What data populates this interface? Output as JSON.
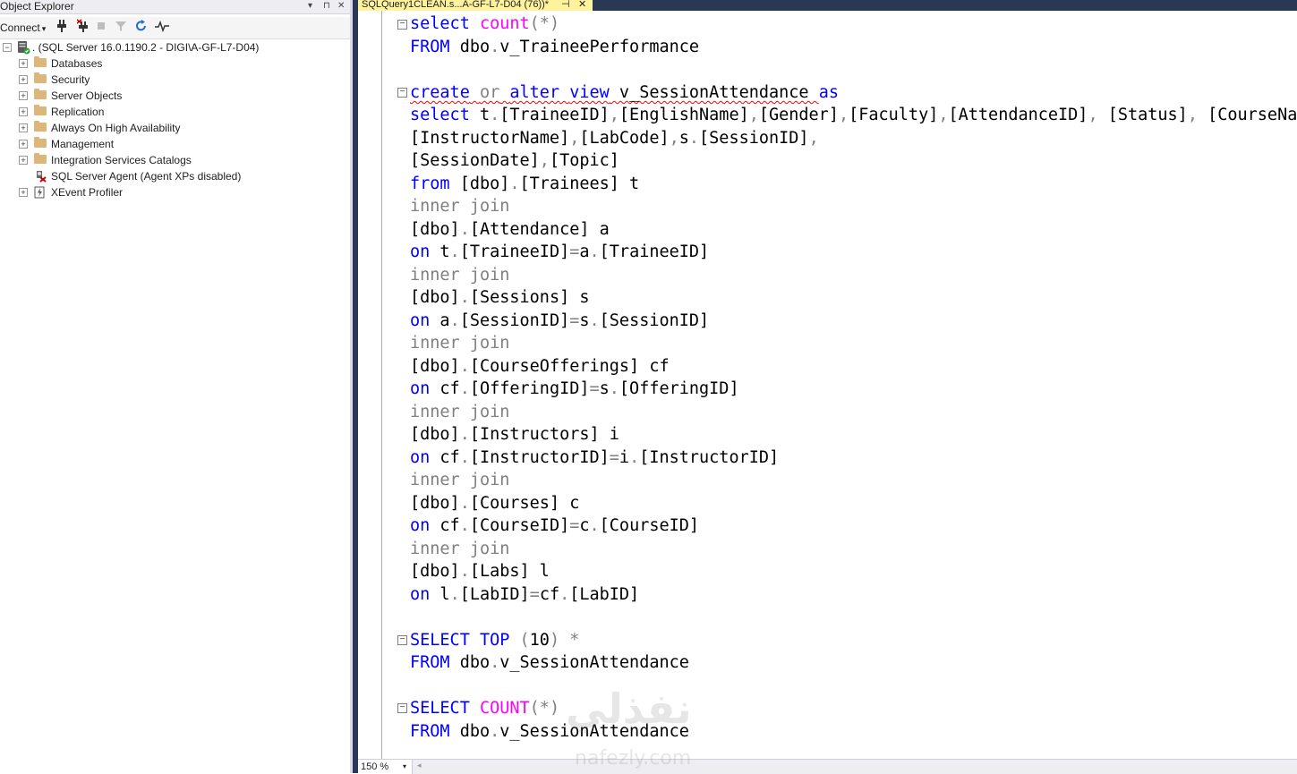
{
  "object_explorer": {
    "title": "Object Explorer",
    "title_controls": {
      "dropdown": "▾",
      "pin": "⊓",
      "close": "✕"
    },
    "toolbar": {
      "connect_label": "Connect",
      "connect_caret": "▾"
    },
    "server_node": ". (SQL Server 16.0.1190.2 - DIGI\\A-GF-L7-D04)",
    "items": [
      {
        "label": "Databases",
        "icon": "folder-icon"
      },
      {
        "label": "Security",
        "icon": "folder-icon"
      },
      {
        "label": "Server Objects",
        "icon": "folder-icon"
      },
      {
        "label": "Replication",
        "icon": "folder-icon"
      },
      {
        "label": "Always On High Availability",
        "icon": "folder-icon"
      },
      {
        "label": "Management",
        "icon": "folder-icon"
      },
      {
        "label": "Integration Services Catalogs",
        "icon": "folder-icon"
      },
      {
        "label": "SQL Server Agent (Agent XPs disabled)",
        "icon": "agent-icon"
      },
      {
        "label": "XEvent Profiler",
        "icon": "xevent-icon"
      }
    ],
    "expand_glyph": "+",
    "collapse_glyph": "−"
  },
  "editor": {
    "tab_title": "SQLQuery1CLEAN.s...A-GF-L7-D04 (76))*",
    "tab_pin": "⊣",
    "tab_close": "✕",
    "fold_glyph": "−",
    "code": {
      "l1_a": "select",
      "l1_b": " ",
      "l1_c": "count",
      "l1_d": "(*)",
      "l2_a": "FROM",
      "l2_b": " dbo",
      "l2_c": ".",
      "l2_d": "v_TraineePerformance",
      "l4_a": "create",
      "l4_b": " ",
      "l4_c": "or",
      "l4_d": " ",
      "l4_e": "alter",
      "l4_f": " ",
      "l4_g": "view",
      "l4_h": " v_SessionAttendance ",
      "l4_i": "as",
      "l5_a": "select",
      "l5_b": " t",
      "l5_c": ".",
      "l5_d": "[TraineeID]",
      "l5_e": ",",
      "l5_f": "[EnglishName]",
      "l5_g": ",",
      "l5_h": "[Gender]",
      "l5_i": ",",
      "l5_j": "[Faculty]",
      "l5_k": ",",
      "l5_l": "[AttendanceID]",
      "l5_m": ", ",
      "l5_n": "[Status]",
      "l5_o": ", ",
      "l5_p": "[CourseName]",
      "l5_q": ",",
      "l6_a": "[InstructorName]",
      "l6_b": ",",
      "l6_c": "[LabCode]",
      "l6_d": ",",
      "l6_e": "s",
      "l6_f": ".",
      "l6_g": "[SessionID]",
      "l6_h": ",",
      "l7_a": "[SessionDate]",
      "l7_b": ",",
      "l7_c": "[Topic]",
      "l8_a": "from",
      "l8_b": " [dbo]",
      "l8_c": ".",
      "l8_d": "[Trainees] t",
      "join": "inner join",
      "l10_a": "[dbo]",
      "l10_b": ".",
      "l10_c": "[Attendance] a",
      "l11_a": "on",
      "l11_b": " t",
      "l11_c": ".",
      "l11_d": "[TraineeID]",
      "l11_e": "=",
      "l11_f": "a",
      "l11_g": ".",
      "l11_h": "[TraineeID]",
      "l13_a": "[dbo]",
      "l13_b": ".",
      "l13_c": "[Sessions] s",
      "l14_a": "on",
      "l14_b": " a",
      "l14_c": ".",
      "l14_d": "[SessionID]",
      "l14_e": "=",
      "l14_f": "s",
      "l14_g": ".",
      "l14_h": "[SessionID]",
      "l16_a": "[dbo]",
      "l16_b": ".",
      "l16_c": "[CourseOfferings] cf",
      "l17_a": "on",
      "l17_b": " cf",
      "l17_c": ".",
      "l17_d": "[OfferingID]",
      "l17_e": "=",
      "l17_f": "s",
      "l17_g": ".",
      "l17_h": "[OfferingID]",
      "l19_a": "[dbo]",
      "l19_b": ".",
      "l19_c": "[Instructors] i",
      "l20_a": "on",
      "l20_b": " cf",
      "l20_c": ".",
      "l20_d": "[InstructorID]",
      "l20_e": "=",
      "l20_f": "i",
      "l20_g": ".",
      "l20_h": "[InstructorID]",
      "l22_a": "[dbo]",
      "l22_b": ".",
      "l22_c": "[Courses] c",
      "l23_a": "on",
      "l23_b": " cf",
      "l23_c": ".",
      "l23_d": "[CourseID]",
      "l23_e": "=",
      "l23_f": "c",
      "l23_g": ".",
      "l23_h": "[CourseID]",
      "l25_a": "[dbo]",
      "l25_b": ".",
      "l25_c": "[Labs] l",
      "l26_a": "on",
      "l26_b": " l",
      "l26_c": ".",
      "l26_d": "[LabID]",
      "l26_e": "=",
      "l26_f": "cf",
      "l26_g": ".",
      "l26_h": "[LabID]",
      "l28_a": "SELECT",
      "l28_b": " ",
      "l28_c": "TOP",
      "l28_d": " (",
      "l28_e": "10",
      "l28_f": ") *",
      "l29_a": "FROM",
      "l29_b": " dbo",
      "l29_c": ".",
      "l29_d": "v_SessionAttendance",
      "l31_a": "SELECT",
      "l31_b": " ",
      "l31_c": "COUNT",
      "l31_d": "(*)",
      "l32_a": "FROM",
      "l32_b": " dbo",
      "l32_c": ".",
      "l32_d": "v_SessionAttendance"
    }
  },
  "status": {
    "zoom": "150 %",
    "zoom_caret": "▾",
    "scroll_left": "◂"
  },
  "watermark": {
    "arabic": "نفذلي",
    "latin": "nafezly.com"
  },
  "colors": {
    "keyword": "#0000ff",
    "function": "#ff00ff",
    "operator": "#808080",
    "tab_active": "#fff29d",
    "frame": "#293955"
  }
}
